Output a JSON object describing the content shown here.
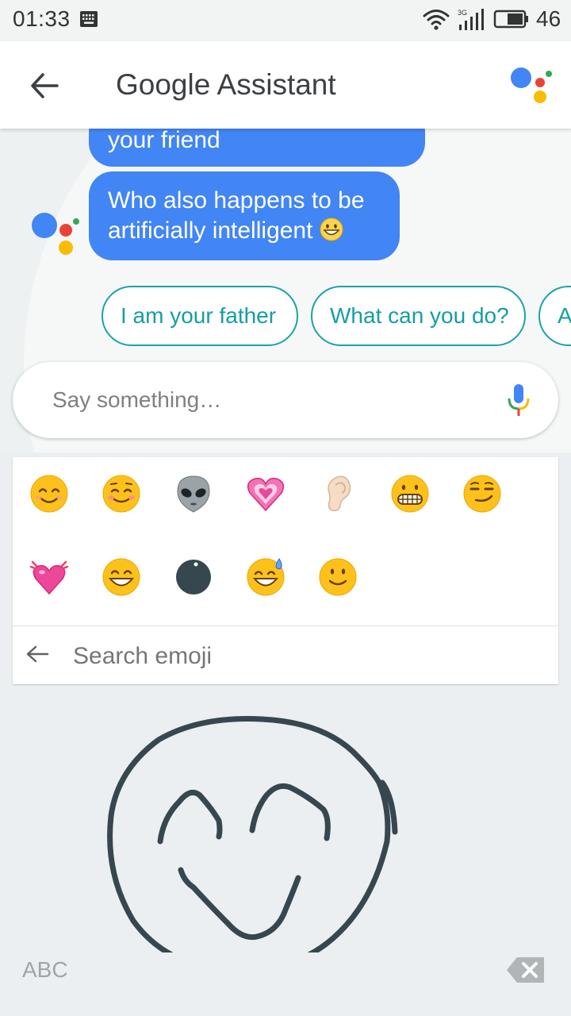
{
  "status_bar": {
    "time": "01:33",
    "network_label": "3G",
    "battery_level": "46"
  },
  "app_bar": {
    "title": "Google Assistant",
    "back_icon": "arrow-back-icon",
    "brand_icon": "google-assistant-dots-icon"
  },
  "conversation": {
    "messages": [
      {
        "sender": "assistant",
        "lines": [
          "your friend"
        ]
      },
      {
        "sender": "assistant",
        "lines": [
          "Who also happens to be",
          "artificially intelligent"
        ],
        "trailing_emoji": "grinning-face"
      }
    ]
  },
  "suggestions": [
    {
      "label": "I am your father"
    },
    {
      "label": "What can you do?"
    },
    {
      "label": "A"
    }
  ],
  "composer": {
    "placeholder": "Say something…",
    "mic_icon": "microphone-icon"
  },
  "emoji_panel": {
    "results": [
      "smiling-face-with-smiling-eyes",
      "smiling-face",
      "alien",
      "growing-heart",
      "ear",
      "grimacing-face",
      "smirking-face",
      "beating-heart",
      "grinning-face-with-smiling-eyes",
      "black-circle",
      "grinning-face-with-sweat",
      "slightly-smiling-face"
    ],
    "search_placeholder": "Search emoji"
  },
  "keyboard": {
    "mode_key_label": "ABC",
    "delete_icon": "backspace-icon"
  },
  "colors": {
    "assistant_bubble": "#4285f4",
    "chip_accent": "#1aa3a8",
    "google_blue": "#4285f4",
    "google_red": "#ea4335",
    "google_yellow": "#fbbc05",
    "google_green": "#34a853",
    "ink": "#37474f"
  }
}
